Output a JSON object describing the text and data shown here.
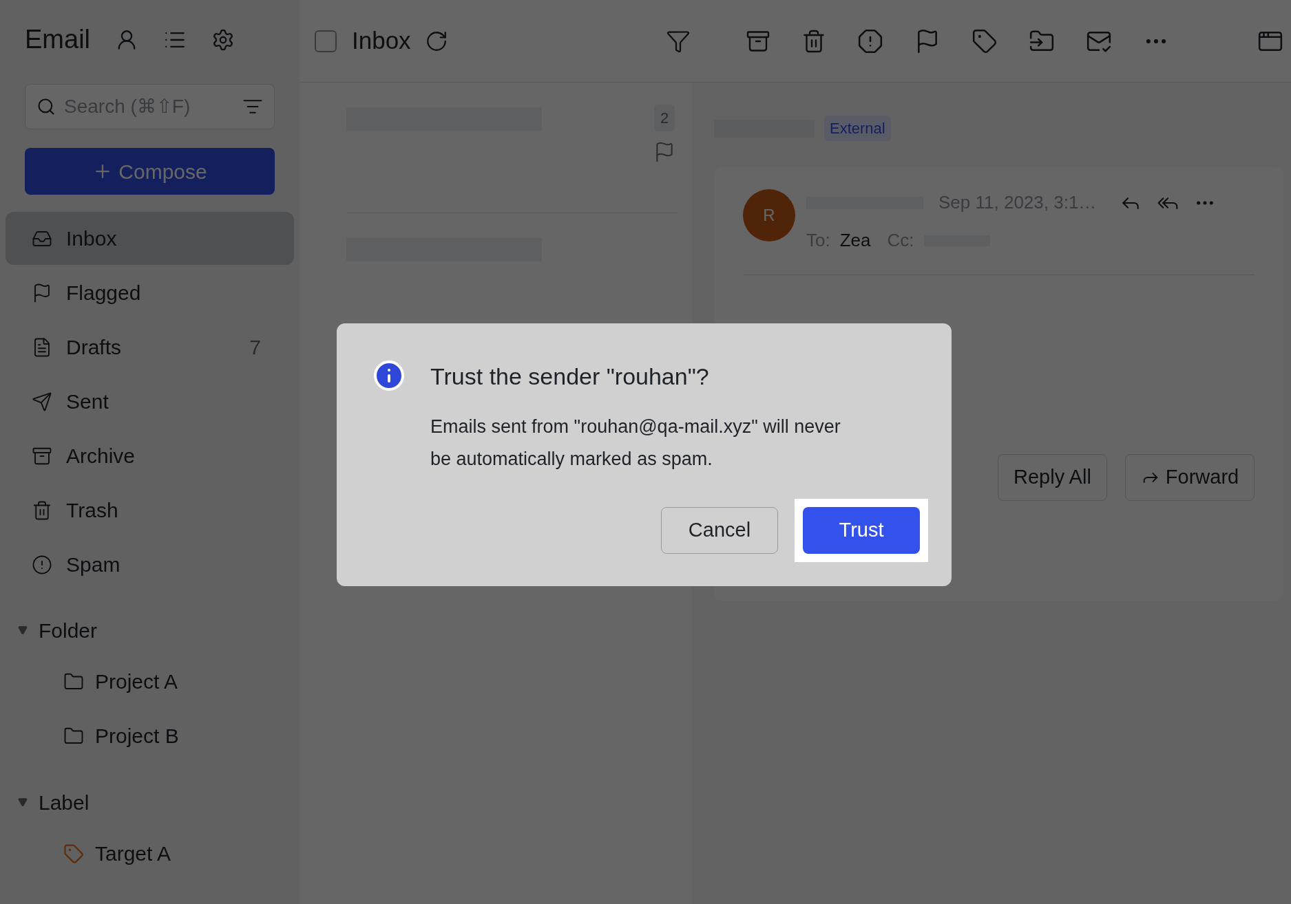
{
  "sidebar": {
    "title": "Email",
    "search": {
      "placeholder": "Search (⌘⇧F)"
    },
    "compose": "Compose",
    "items": [
      {
        "label": "Inbox",
        "kind": "inbox",
        "selected": true
      },
      {
        "label": "Flagged",
        "kind": "flag",
        "selected": false
      },
      {
        "label": "Drafts",
        "kind": "drafts",
        "count": "7",
        "selected": false
      },
      {
        "label": "Sent",
        "kind": "sent",
        "selected": false
      },
      {
        "label": "Archive",
        "kind": "archive",
        "selected": false
      },
      {
        "label": "Trash",
        "kind": "trash",
        "selected": false
      },
      {
        "label": "Spam",
        "kind": "spam",
        "selected": false
      }
    ],
    "sections": [
      {
        "label": "Folder",
        "expanded": true,
        "children": [
          {
            "label": "Project A",
            "kind": "folder"
          },
          {
            "label": "Project B",
            "kind": "folder"
          }
        ]
      },
      {
        "label": "Label",
        "expanded": true,
        "children": [
          {
            "label": "Target A",
            "kind": "label"
          }
        ]
      }
    ]
  },
  "toolbar": {
    "title": "Inbox",
    "checked": false
  },
  "messages": [
    {
      "badge": "2",
      "flagged": true
    },
    {
      "flagged": false
    }
  ],
  "reader": {
    "tag": "External",
    "avatar": "R",
    "date": "Sep 11, 2023, 3:1…",
    "to_label": "To:",
    "to": "Zea",
    "cc_label": "Cc:",
    "buttons": [
      "Reply All",
      "Forward"
    ]
  },
  "dialog": {
    "title": "Trust the sender \"rouhan\"?",
    "message": "Emails sent from \"rouhan@qa-mail.xyz\" will never be automatically marked as spam.",
    "buttons": [
      {
        "label": "Cancel",
        "kind": "secondary",
        "highlighted": false
      },
      {
        "label": "Trust",
        "kind": "primary",
        "highlighted": true
      }
    ]
  }
}
